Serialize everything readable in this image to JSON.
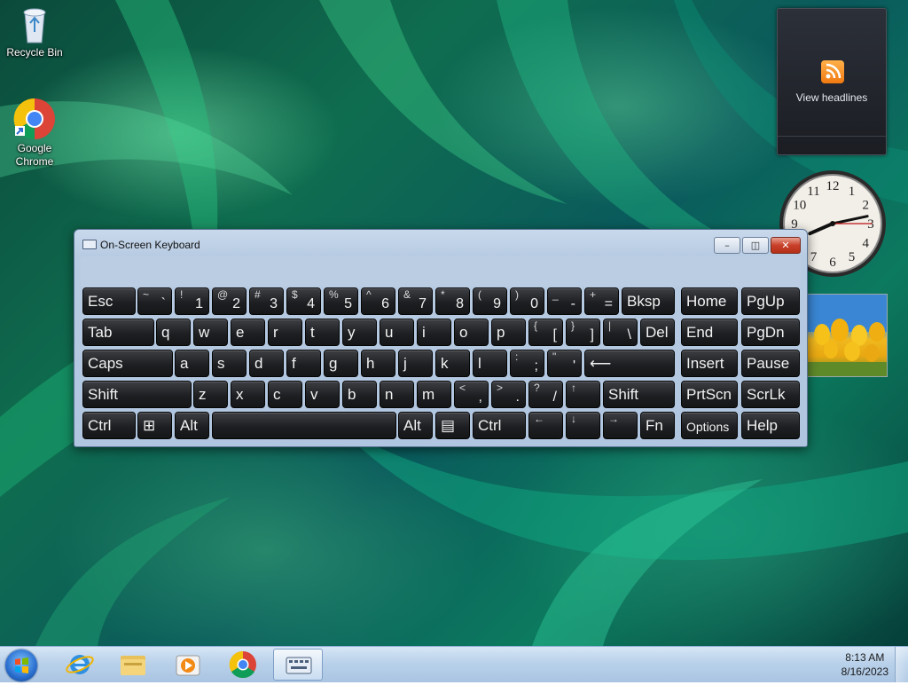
{
  "desktop": {
    "icons": [
      {
        "label": "Recycle Bin",
        "icon": "recycle-bin-icon"
      },
      {
        "label": "Google Chrome",
        "icon": "chrome-icon"
      }
    ]
  },
  "gadgets": {
    "feed_label": "View headlines",
    "clock": {
      "hour": 8,
      "minute": 13,
      "second": 15,
      "numerals": [
        "12",
        "1",
        "2",
        "3",
        "4",
        "5",
        "6",
        "7",
        "8",
        "9",
        "10",
        "11"
      ]
    }
  },
  "osk": {
    "title": "On-Screen Keyboard",
    "buttons": {
      "minimize": "–",
      "restore": "◫",
      "close": "✕"
    },
    "rows": [
      [
        {
          "m": "Esc"
        },
        {
          "s": "~",
          "u": "`"
        },
        {
          "s": "!",
          "u": "1"
        },
        {
          "s": "@",
          "u": "2"
        },
        {
          "s": "#",
          "u": "3"
        },
        {
          "s": "$",
          "u": "4"
        },
        {
          "s": "%",
          "u": "5"
        },
        {
          "s": "^",
          "u": "6"
        },
        {
          "s": "&",
          "u": "7"
        },
        {
          "s": "*",
          "u": "8"
        },
        {
          "s": "(",
          "u": "9"
        },
        {
          "s": ")",
          "u": "0"
        },
        {
          "s": "_",
          "u": "-"
        },
        {
          "s": "+",
          "u": "="
        },
        {
          "m": "Bksp"
        },
        {
          "m": "Home"
        },
        {
          "m": "PgUp"
        }
      ],
      [
        {
          "m": "Tab"
        },
        {
          "m": "q"
        },
        {
          "m": "w"
        },
        {
          "m": "e"
        },
        {
          "m": "r"
        },
        {
          "m": "t"
        },
        {
          "m": "y"
        },
        {
          "m": "u"
        },
        {
          "m": "i"
        },
        {
          "m": "o"
        },
        {
          "m": "p"
        },
        {
          "s": "{",
          "u": "["
        },
        {
          "s": "}",
          "u": "]"
        },
        {
          "s": "|",
          "u": "\\"
        },
        {
          "m": "Del"
        },
        {
          "m": "End"
        },
        {
          "m": "PgDn"
        }
      ],
      [
        {
          "m": "Caps"
        },
        {
          "m": "a"
        },
        {
          "m": "s"
        },
        {
          "m": "d"
        },
        {
          "m": "f"
        },
        {
          "m": "g"
        },
        {
          "m": "h"
        },
        {
          "m": "j"
        },
        {
          "m": "k"
        },
        {
          "m": "l"
        },
        {
          "s": ":",
          "u": ";"
        },
        {
          "s": "\"",
          "u": "'"
        },
        {
          "m": "⟵"
        },
        {
          "m": "Insert"
        },
        {
          "m": "Pause"
        }
      ],
      [
        {
          "m": "Shift"
        },
        {
          "m": "z"
        },
        {
          "m": "x"
        },
        {
          "m": "c"
        },
        {
          "m": "v"
        },
        {
          "m": "b"
        },
        {
          "m": "n"
        },
        {
          "m": "m"
        },
        {
          "s": "<",
          "u": ","
        },
        {
          "s": ">",
          "u": "."
        },
        {
          "s": "?",
          "u": "/"
        },
        {
          "s": "↑",
          "u": ""
        },
        {
          "m": "Shift"
        },
        {
          "m": "PrtScn"
        },
        {
          "m": "ScrLk"
        }
      ],
      [
        {
          "m": "Ctrl"
        },
        {
          "m": "⊞"
        },
        {
          "m": "Alt"
        },
        {
          "m": ""
        },
        {
          "m": "Alt"
        },
        {
          "m": "▤"
        },
        {
          "m": "Ctrl"
        },
        {
          "s": "←",
          "u": ""
        },
        {
          "s": "↓",
          "u": ""
        },
        {
          "s": "→",
          "u": ""
        },
        {
          "m": "Fn"
        },
        {
          "m": "Options"
        },
        {
          "m": "Help"
        }
      ]
    ]
  },
  "taskbar": {
    "items": [
      {
        "name": "internet-explorer-icon"
      },
      {
        "name": "file-explorer-icon"
      },
      {
        "name": "media-player-icon"
      },
      {
        "name": "chrome-icon"
      },
      {
        "name": "on-screen-keyboard-icon",
        "active": true
      }
    ],
    "time": "8:13 AM",
    "date": "8/16/2023"
  }
}
